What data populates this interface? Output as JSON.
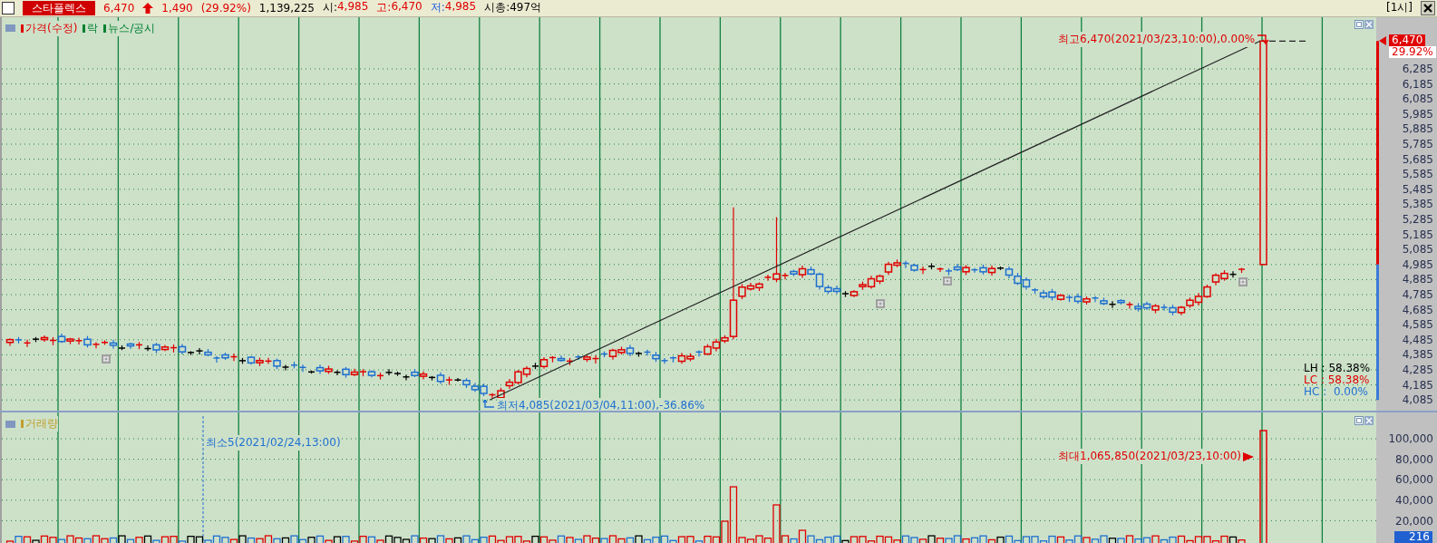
{
  "header": {
    "checked": false,
    "stock_name": "스타플렉스",
    "price": "6,470",
    "change": "1,490",
    "change_rate": "(29.92%)",
    "volume": "1,139,225",
    "open_label": "시:",
    "open": "4,985",
    "high_label": "고:",
    "high": "6,470",
    "low_label": "저:",
    "low": "4,985",
    "market_cap": "시총:497억",
    "interval": "[1시]"
  },
  "price_pane": {
    "legend": [
      {
        "label": "가격(수정)",
        "color": "#e00000"
      },
      {
        "label": "락",
        "color": "#008030"
      },
      {
        "label": "뉴스/공시",
        "color": "#008030"
      }
    ],
    "high_annotation": "최고6,470(2021/03/23,10:00),0.00%",
    "low_annotation": "최저4,085(2021/03/04,11:00),-36.86%",
    "current_price": "6,470",
    "current_rate": "29.92%",
    "axis_ticks": [
      "6,285",
      "6,185",
      "6,085",
      "5,985",
      "5,885",
      "5,785",
      "5,685",
      "5,585",
      "5,485",
      "5,385",
      "5,285",
      "5,185",
      "5,085",
      "4,985",
      "4,885",
      "4,785",
      "4,685",
      "4,585",
      "4,485",
      "4,385",
      "4,285",
      "4,185",
      "4,085"
    ],
    "stats": [
      {
        "text": "LH : 58.38%",
        "color": "#000000"
      },
      {
        "text": "LC : 58.38%",
        "color": "#e00000"
      },
      {
        "text": "HC :  0.00%",
        "color": "#2070d0"
      }
    ]
  },
  "volume_pane": {
    "legend": "거래량",
    "max_annotation": "최대1,065,850(2021/03/23,10:00)",
    "min_annotation": "최소5(2021/02/24,13:00)",
    "axis_ticks": [
      "100,000",
      "80,000",
      "60,000",
      "40,000",
      "20,000"
    ],
    "current_volume": "216"
  }
}
